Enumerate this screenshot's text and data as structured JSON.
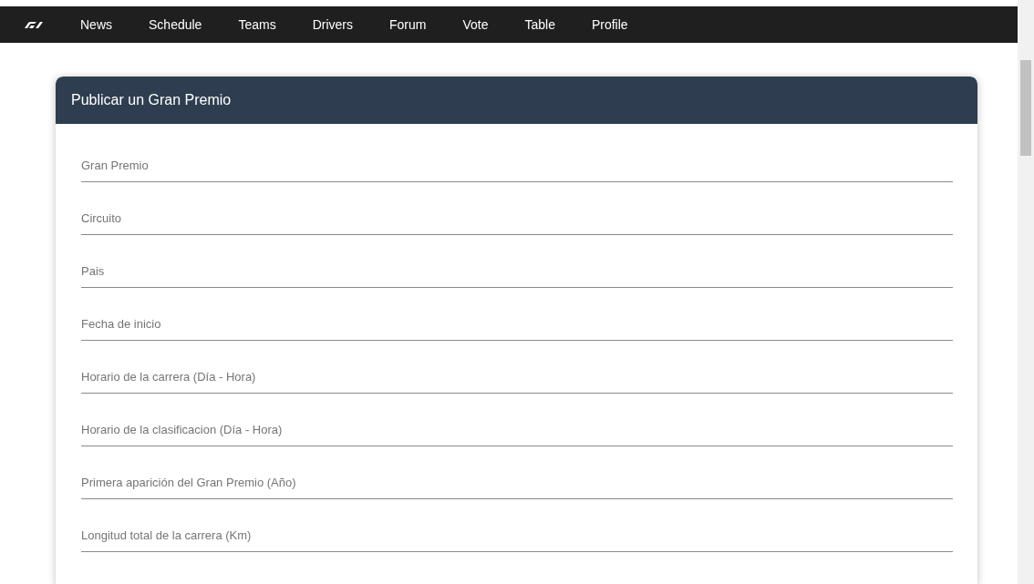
{
  "nav": {
    "items": [
      {
        "label": "News"
      },
      {
        "label": "Schedule"
      },
      {
        "label": "Teams"
      },
      {
        "label": "Drivers"
      },
      {
        "label": "Forum"
      },
      {
        "label": "Vote"
      },
      {
        "label": "Table"
      },
      {
        "label": "Profile"
      }
    ]
  },
  "form": {
    "title": "Publicar un Gran Premio",
    "fields": [
      {
        "placeholder": "Gran Premio"
      },
      {
        "placeholder": "Circuito"
      },
      {
        "placeholder": "Pais"
      },
      {
        "placeholder": "Fecha de inicio"
      },
      {
        "placeholder": "Horario de la carrera (Día - Hora)"
      },
      {
        "placeholder": "Horario de la clasificacion (Día - Hora)"
      },
      {
        "placeholder": "Primera aparición del Gran Premio (Año)"
      },
      {
        "placeholder": "Longitud total de la carrera (Km)"
      }
    ]
  }
}
